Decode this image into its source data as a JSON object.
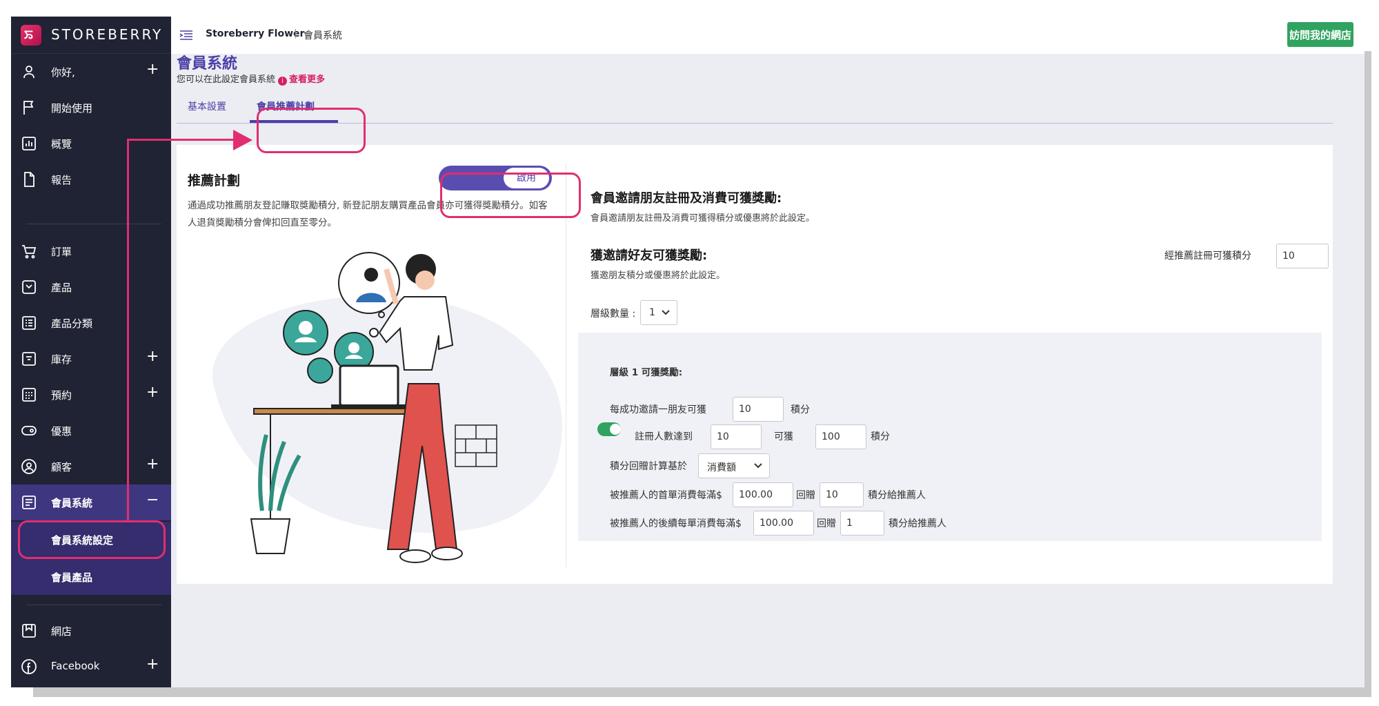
{
  "brand": {
    "name": "STOREBERRY",
    "logo_glyph": "ꯢ"
  },
  "sidebar": {
    "items": [
      {
        "label": "你好,",
        "icon": "user-icon",
        "expand": "+"
      },
      {
        "label": "開始使用",
        "icon": "flag-icon",
        "expand": ""
      },
      {
        "label": "概覽",
        "icon": "chart-icon",
        "expand": ""
      },
      {
        "label": "報告",
        "icon": "document-icon",
        "expand": ""
      },
      {
        "label": "訂單",
        "icon": "cart-icon",
        "expand": ""
      },
      {
        "label": "產品",
        "icon": "box-icon",
        "expand": ""
      },
      {
        "label": "產品分類",
        "icon": "list-icon",
        "expand": ""
      },
      {
        "label": "庫存",
        "icon": "inventory-icon",
        "expand": "+"
      },
      {
        "label": "預約",
        "icon": "calendar-icon",
        "expand": "+"
      },
      {
        "label": "優惠",
        "icon": "ticket-icon",
        "expand": ""
      },
      {
        "label": "顧客",
        "icon": "customer-icon",
        "expand": "+"
      },
      {
        "label": "會員系統",
        "icon": "member-icon",
        "expand": "−"
      },
      {
        "label": "網店",
        "icon": "store-icon",
        "expand": ""
      },
      {
        "label": "Facebook",
        "icon": "facebook-icon",
        "expand": "+"
      }
    ],
    "submenu": [
      {
        "label": "會員系統設定"
      },
      {
        "label": "會員產品"
      }
    ]
  },
  "topbar": {
    "store": "Storeberry Flower",
    "separator": "|",
    "page": "會員系統",
    "visit_button": "訪問我的網店"
  },
  "page": {
    "title": "會員系統",
    "subtitle": "您可以在此設定會員系統",
    "more_link": "查看更多",
    "info_glyph": "i",
    "tabs": [
      {
        "label": "基本設置",
        "active": false
      },
      {
        "label": "會員推薦計劃",
        "active": true
      }
    ]
  },
  "referral": {
    "title": "推薦計劃",
    "description": "通過成功推薦朋友登記賺取獎勵積分, 新登記朋友購買產品會員亦可獲得獎勵積分。如客人退貨獎勵積分會俾扣回直至零分。",
    "toggle_label": "啟用",
    "enabled": true
  },
  "rewards": {
    "member_heading": "會員邀請朋友註冊及消費可獲獎勵:",
    "member_sub": "會員邀請朋友註冊及消費可獲得積分或優惠將於此設定。",
    "invitee_heading": "獲邀請好友可獲獎勵:",
    "invitee_sub": "獲邀朋友積分或優惠將於此設定。",
    "signup_points_label": "經推薦註冊可獲積分",
    "signup_points_value": "10",
    "tier_count_label": "層級數量 :",
    "tier_count_value": "1"
  },
  "tier": {
    "heading": "層級 1 可獲獎勵:",
    "per_invite_label": "每成功邀請一朋友可獲",
    "per_invite_value": "10",
    "points_unit": "積分",
    "milestone_enabled": true,
    "milestone_label": "註冊人數達到",
    "milestone_value": "10",
    "milestone_get": "可獲",
    "milestone_points": "100",
    "calc_basis_label": "積分回贈計算基於",
    "calc_basis_value": "消費額",
    "first_order_label": "被推薦人的首單消費每滿$",
    "first_order_amount": "100.00",
    "give_back": "回贈",
    "first_order_points": "10",
    "to_referrer": "積分給推薦人",
    "later_order_label": "被推薦人的後續每單消費每滿$",
    "later_order_amount": "100.00",
    "later_order_points": "1"
  },
  "colors": {
    "sidebar_bg": "#1f2333",
    "accent_purple": "#4b3fa6",
    "annotation_pink": "#e12e70",
    "visit_green": "#2fa35f"
  }
}
